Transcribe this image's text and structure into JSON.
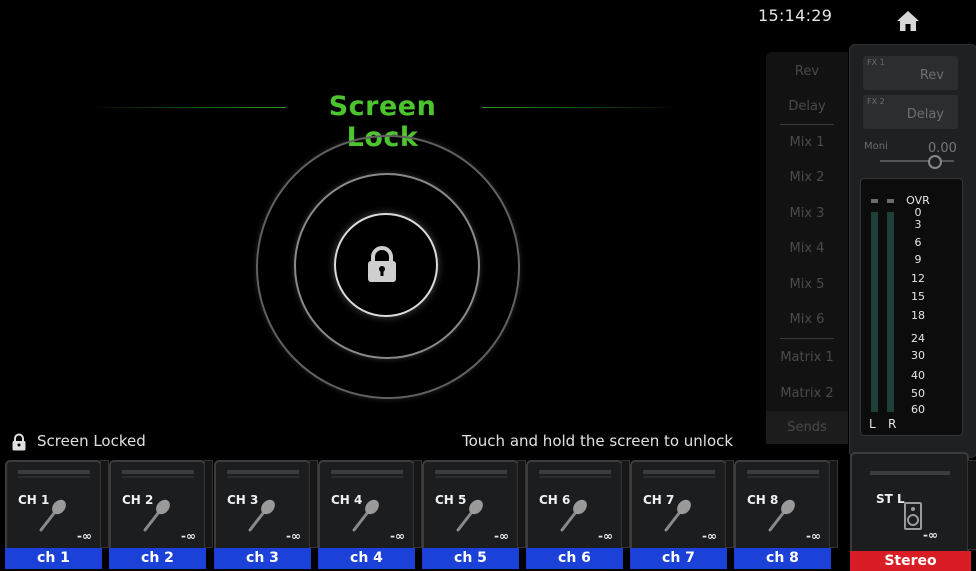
{
  "clock": "15:14:29",
  "title": "Screen Lock",
  "status": {
    "locked_text": "Screen Locked",
    "unlock_hint": "Touch and hold the screen to unlock"
  },
  "sends": [
    "Rev",
    "Delay",
    "Mix 1",
    "Mix 2",
    "Mix 3",
    "Mix 4",
    "Mix 5",
    "Mix 6",
    "Matrix 1",
    "Matrix 2",
    "Sends"
  ],
  "fx": [
    {
      "tag": "FX 1",
      "label": "Rev"
    },
    {
      "tag": "FX 2",
      "label": "Delay"
    }
  ],
  "moni": {
    "label": "Moni",
    "value": "0.00"
  },
  "meter": {
    "scale": [
      "OVR",
      "0",
      "3",
      "6",
      "9",
      "12",
      "15",
      "18",
      "24",
      "30",
      "40",
      "50",
      "60"
    ],
    "left_label": "L",
    "right_label": "R"
  },
  "channels": [
    {
      "id": "CH 1",
      "name": "ch 1",
      "level": "-∞"
    },
    {
      "id": "CH 2",
      "name": "ch 2",
      "level": "-∞"
    },
    {
      "id": "CH 3",
      "name": "ch 3",
      "level": "-∞"
    },
    {
      "id": "CH 4",
      "name": "ch 4",
      "level": "-∞"
    },
    {
      "id": "CH 5",
      "name": "ch 5",
      "level": "-∞"
    },
    {
      "id": "CH 6",
      "name": "ch 6",
      "level": "-∞"
    },
    {
      "id": "CH 7",
      "name": "ch 7",
      "level": "-∞"
    },
    {
      "id": "CH 8",
      "name": "ch 8",
      "level": "-∞"
    }
  ],
  "stereo": {
    "id": "ST L",
    "name": "Stereo",
    "level": "-∞"
  },
  "colors": {
    "title_green": "#4bc42d",
    "channel_blue": "#1c41d8",
    "stereo_red": "#d81e24"
  },
  "icons": {
    "home": "home-icon",
    "lock": "lock-icon",
    "mic": "microphone-icon",
    "speaker": "speaker-icon"
  }
}
